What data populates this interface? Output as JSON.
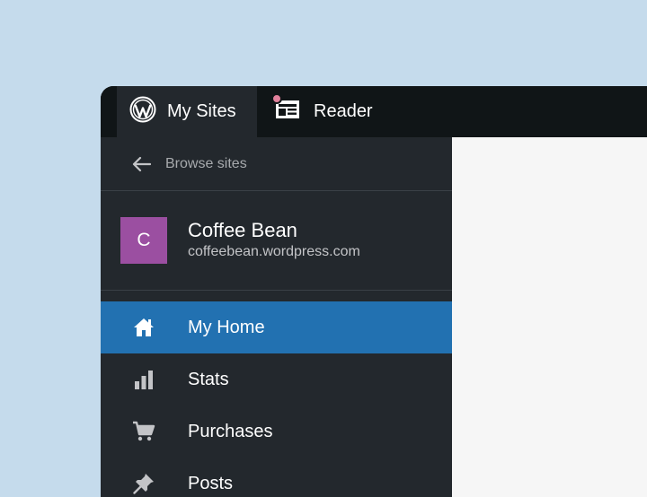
{
  "masterbar": {
    "my_sites_label": "My Sites",
    "reader_label": "Reader",
    "reader_has_notification": true
  },
  "sidebar": {
    "browse_label": "Browse sites",
    "site": {
      "avatar_letter": "C",
      "name": "Coffee Bean",
      "url": "coffeebean.wordpress.com"
    },
    "menu": [
      {
        "label": "My Home",
        "icon": "home-icon",
        "active": true
      },
      {
        "label": "Stats",
        "icon": "stats-icon",
        "active": false
      },
      {
        "label": "Purchases",
        "icon": "cart-icon",
        "active": false
      },
      {
        "label": "Posts",
        "icon": "pin-icon",
        "active": false
      }
    ]
  },
  "colors": {
    "background": "#c5dbec",
    "masterbar": "#101517",
    "sidebar": "#23282d",
    "active_item": "#2271b1",
    "avatar": "#9b4fa1",
    "notification_dot": "#e2819c"
  }
}
